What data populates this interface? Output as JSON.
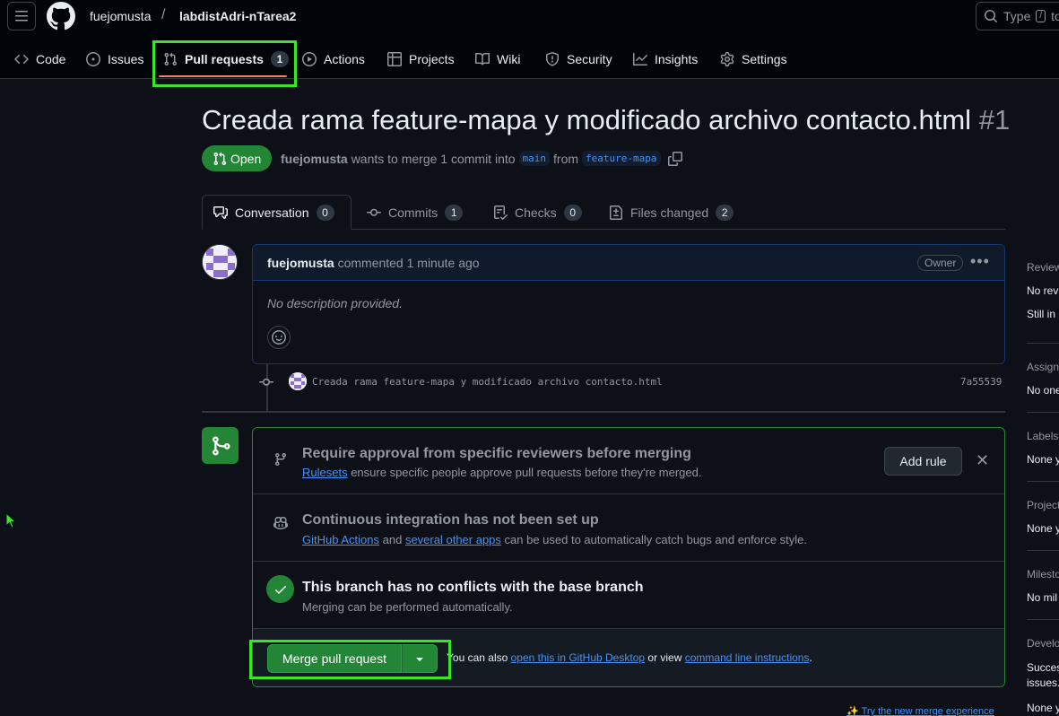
{
  "header": {
    "owner": "fuejomusta",
    "separator": "/",
    "repo": "labdistAdri-nTarea2",
    "search_label": "Type",
    "search_key": "/",
    "search_suffix": "to"
  },
  "nav": [
    {
      "label": "Code",
      "icon": "code-icon"
    },
    {
      "label": "Issues",
      "icon": "issue-icon"
    },
    {
      "label": "Pull requests",
      "icon": "pull-request-icon",
      "count": "1",
      "active": true
    },
    {
      "label": "Actions",
      "icon": "play-icon"
    },
    {
      "label": "Projects",
      "icon": "table-icon"
    },
    {
      "label": "Wiki",
      "icon": "book-icon"
    },
    {
      "label": "Security",
      "icon": "shield-icon"
    },
    {
      "label": "Insights",
      "icon": "graph-icon"
    },
    {
      "label": "Settings",
      "icon": "gear-icon"
    }
  ],
  "pr": {
    "title": "Creada rama feature-mapa y modificado archivo contacto.html",
    "number": "#1",
    "state": "Open",
    "author": "fuejomusta",
    "merge_text": "wants to merge 1 commit into",
    "base": "main",
    "from_text": "from",
    "head": "feature-mapa"
  },
  "tabs": [
    {
      "label": "Conversation",
      "count": "0",
      "icon": "comment-icon"
    },
    {
      "label": "Commits",
      "count": "1",
      "icon": "commit-icon"
    },
    {
      "label": "Checks",
      "count": "0",
      "icon": "checklist-icon"
    },
    {
      "label": "Files changed",
      "count": "2",
      "icon": "file-diff-icon"
    }
  ],
  "comment": {
    "author": "fuejomusta",
    "action": "commented 1 minute ago",
    "badge": "Owner",
    "body": "No description provided."
  },
  "commit": {
    "message": "Creada rama feature-mapa y modificado archivo contacto.html",
    "sha": "7a55539"
  },
  "merge": {
    "rule_title": "Require approval from specific reviewers before merging",
    "rule_link": "Rulesets",
    "rule_text": "ensure specific people approve pull requests before they're merged.",
    "add_rule": "Add rule",
    "ci_title": "Continuous integration has not been set up",
    "ci_link1": "GitHub Actions",
    "ci_and": "and",
    "ci_link2": "several other apps",
    "ci_text": "can be used to automatically catch bugs and enforce style.",
    "conflict_title": "This branch has no conflicts with the base branch",
    "conflict_sub": "Merging can be performed automatically.",
    "merge_button": "Merge pull request",
    "alt_prefix": "You can also",
    "alt_link1": "open this in GitHub Desktop",
    "alt_mid": "or view",
    "alt_link2": "command line instructions",
    "alt_end": ".",
    "try_new": "Try the new merge experience"
  },
  "sidebar": {
    "reviewers": {
      "head": "Review",
      "lines": [
        "No revi",
        "Still in"
      ]
    },
    "assignees": {
      "head": "Assigne",
      "lines": [
        "No one"
      ]
    },
    "labels": {
      "head": "Labels",
      "lines": [
        "None y"
      ]
    },
    "projects": {
      "head": "Project",
      "lines": [
        "None y"
      ]
    },
    "milestone": {
      "head": "Milesto",
      "lines": [
        "No mil"
      ]
    },
    "development": {
      "head": "Develo",
      "lines": [
        "Succes",
        "issues.",
        "None y"
      ]
    }
  },
  "colors": {
    "accent_green": "#238636",
    "highlight": "#39e626",
    "link": "#4493f8",
    "nav_underline": "#f78166"
  }
}
